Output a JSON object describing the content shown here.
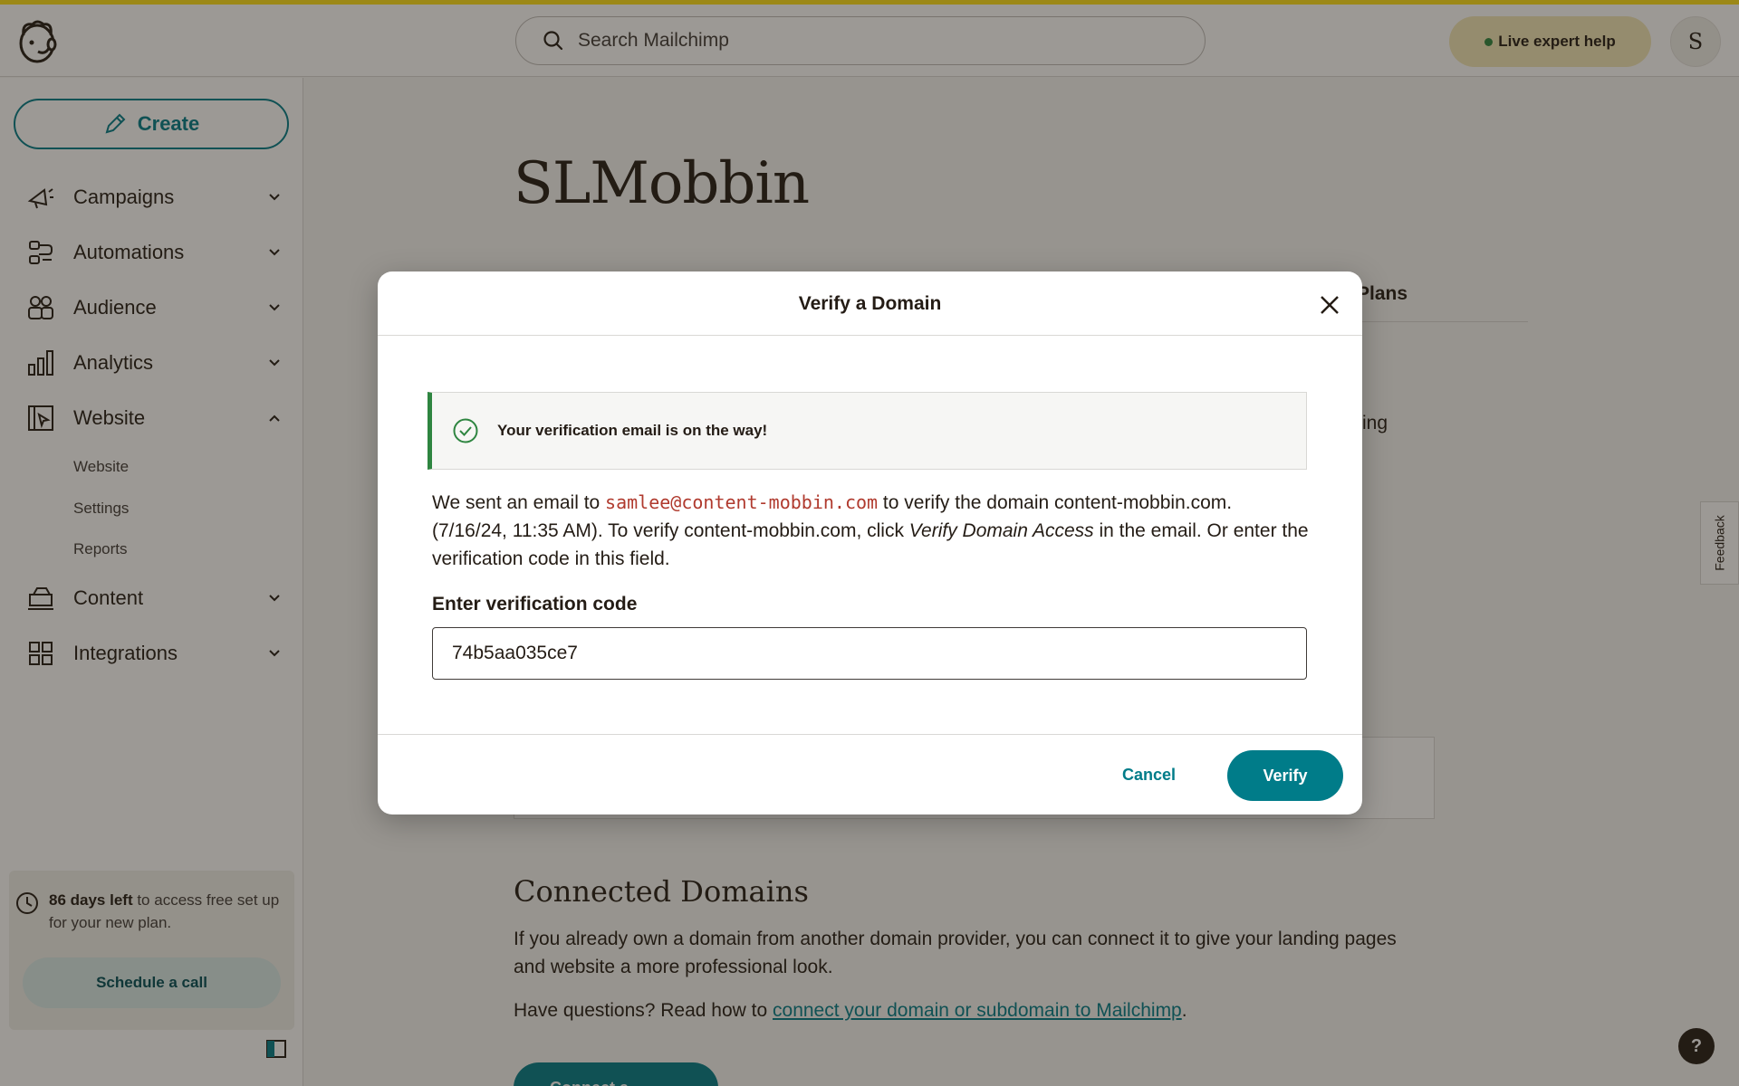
{
  "header": {
    "search_placeholder": "Search Mailchimp",
    "help_label": "Live expert help",
    "avatar_initial": "S"
  },
  "sidebar": {
    "create_label": "Create",
    "items": [
      {
        "label": "Campaigns",
        "icon": "megaphone-icon"
      },
      {
        "label": "Automations",
        "icon": "automations-icon"
      },
      {
        "label": "Audience",
        "icon": "audience-icon"
      },
      {
        "label": "Analytics",
        "icon": "bar-chart-icon"
      },
      {
        "label": "Website",
        "icon": "website-icon"
      },
      {
        "label": "Content",
        "icon": "content-icon"
      },
      {
        "label": "Integrations",
        "icon": "grid-icon"
      }
    ],
    "website_subitems": [
      "Website",
      "Settings",
      "Reports"
    ],
    "trial": {
      "bold": "86 days left",
      "text": " to access free set up for your new plan.",
      "button": "Schedule a call"
    }
  },
  "main": {
    "title": "SLMobbin",
    "tab_fragment": "Plans",
    "text_fragment": "ing",
    "connected": {
      "title": "Connected Domains",
      "desc": "If you already own a domain from another domain provider, you can connect it to give your landing pages and website a more professional look.",
      "question_prefix": "Have questions? Read how to ",
      "link": "connect your domain or subdomain to Mailchimp",
      "question_suffix": ".",
      "button": "Connect a domain"
    },
    "feedback": "Feedback",
    "help_icon": "?"
  },
  "modal": {
    "title": "Verify a Domain",
    "alert": "Your verification email is on the way!",
    "text_1": "We sent an email to ",
    "email": "samlee@content-mobbin.com",
    "text_2": " to verify the domain content-mobbin.com. (7/16/24, 11:35 AM). To verify content-mobbin.com, click ",
    "text_italic": "Verify Domain Access",
    "text_3": " in the email. Or enter the verification code in this field.",
    "field_label": "Enter verification code",
    "code_value": "74b5aa035ce7",
    "cancel": "Cancel",
    "verify": "Verify"
  },
  "colors": {
    "accent": "#007c89",
    "success": "#2e8540",
    "brand_yellow": "#ffe01b"
  }
}
